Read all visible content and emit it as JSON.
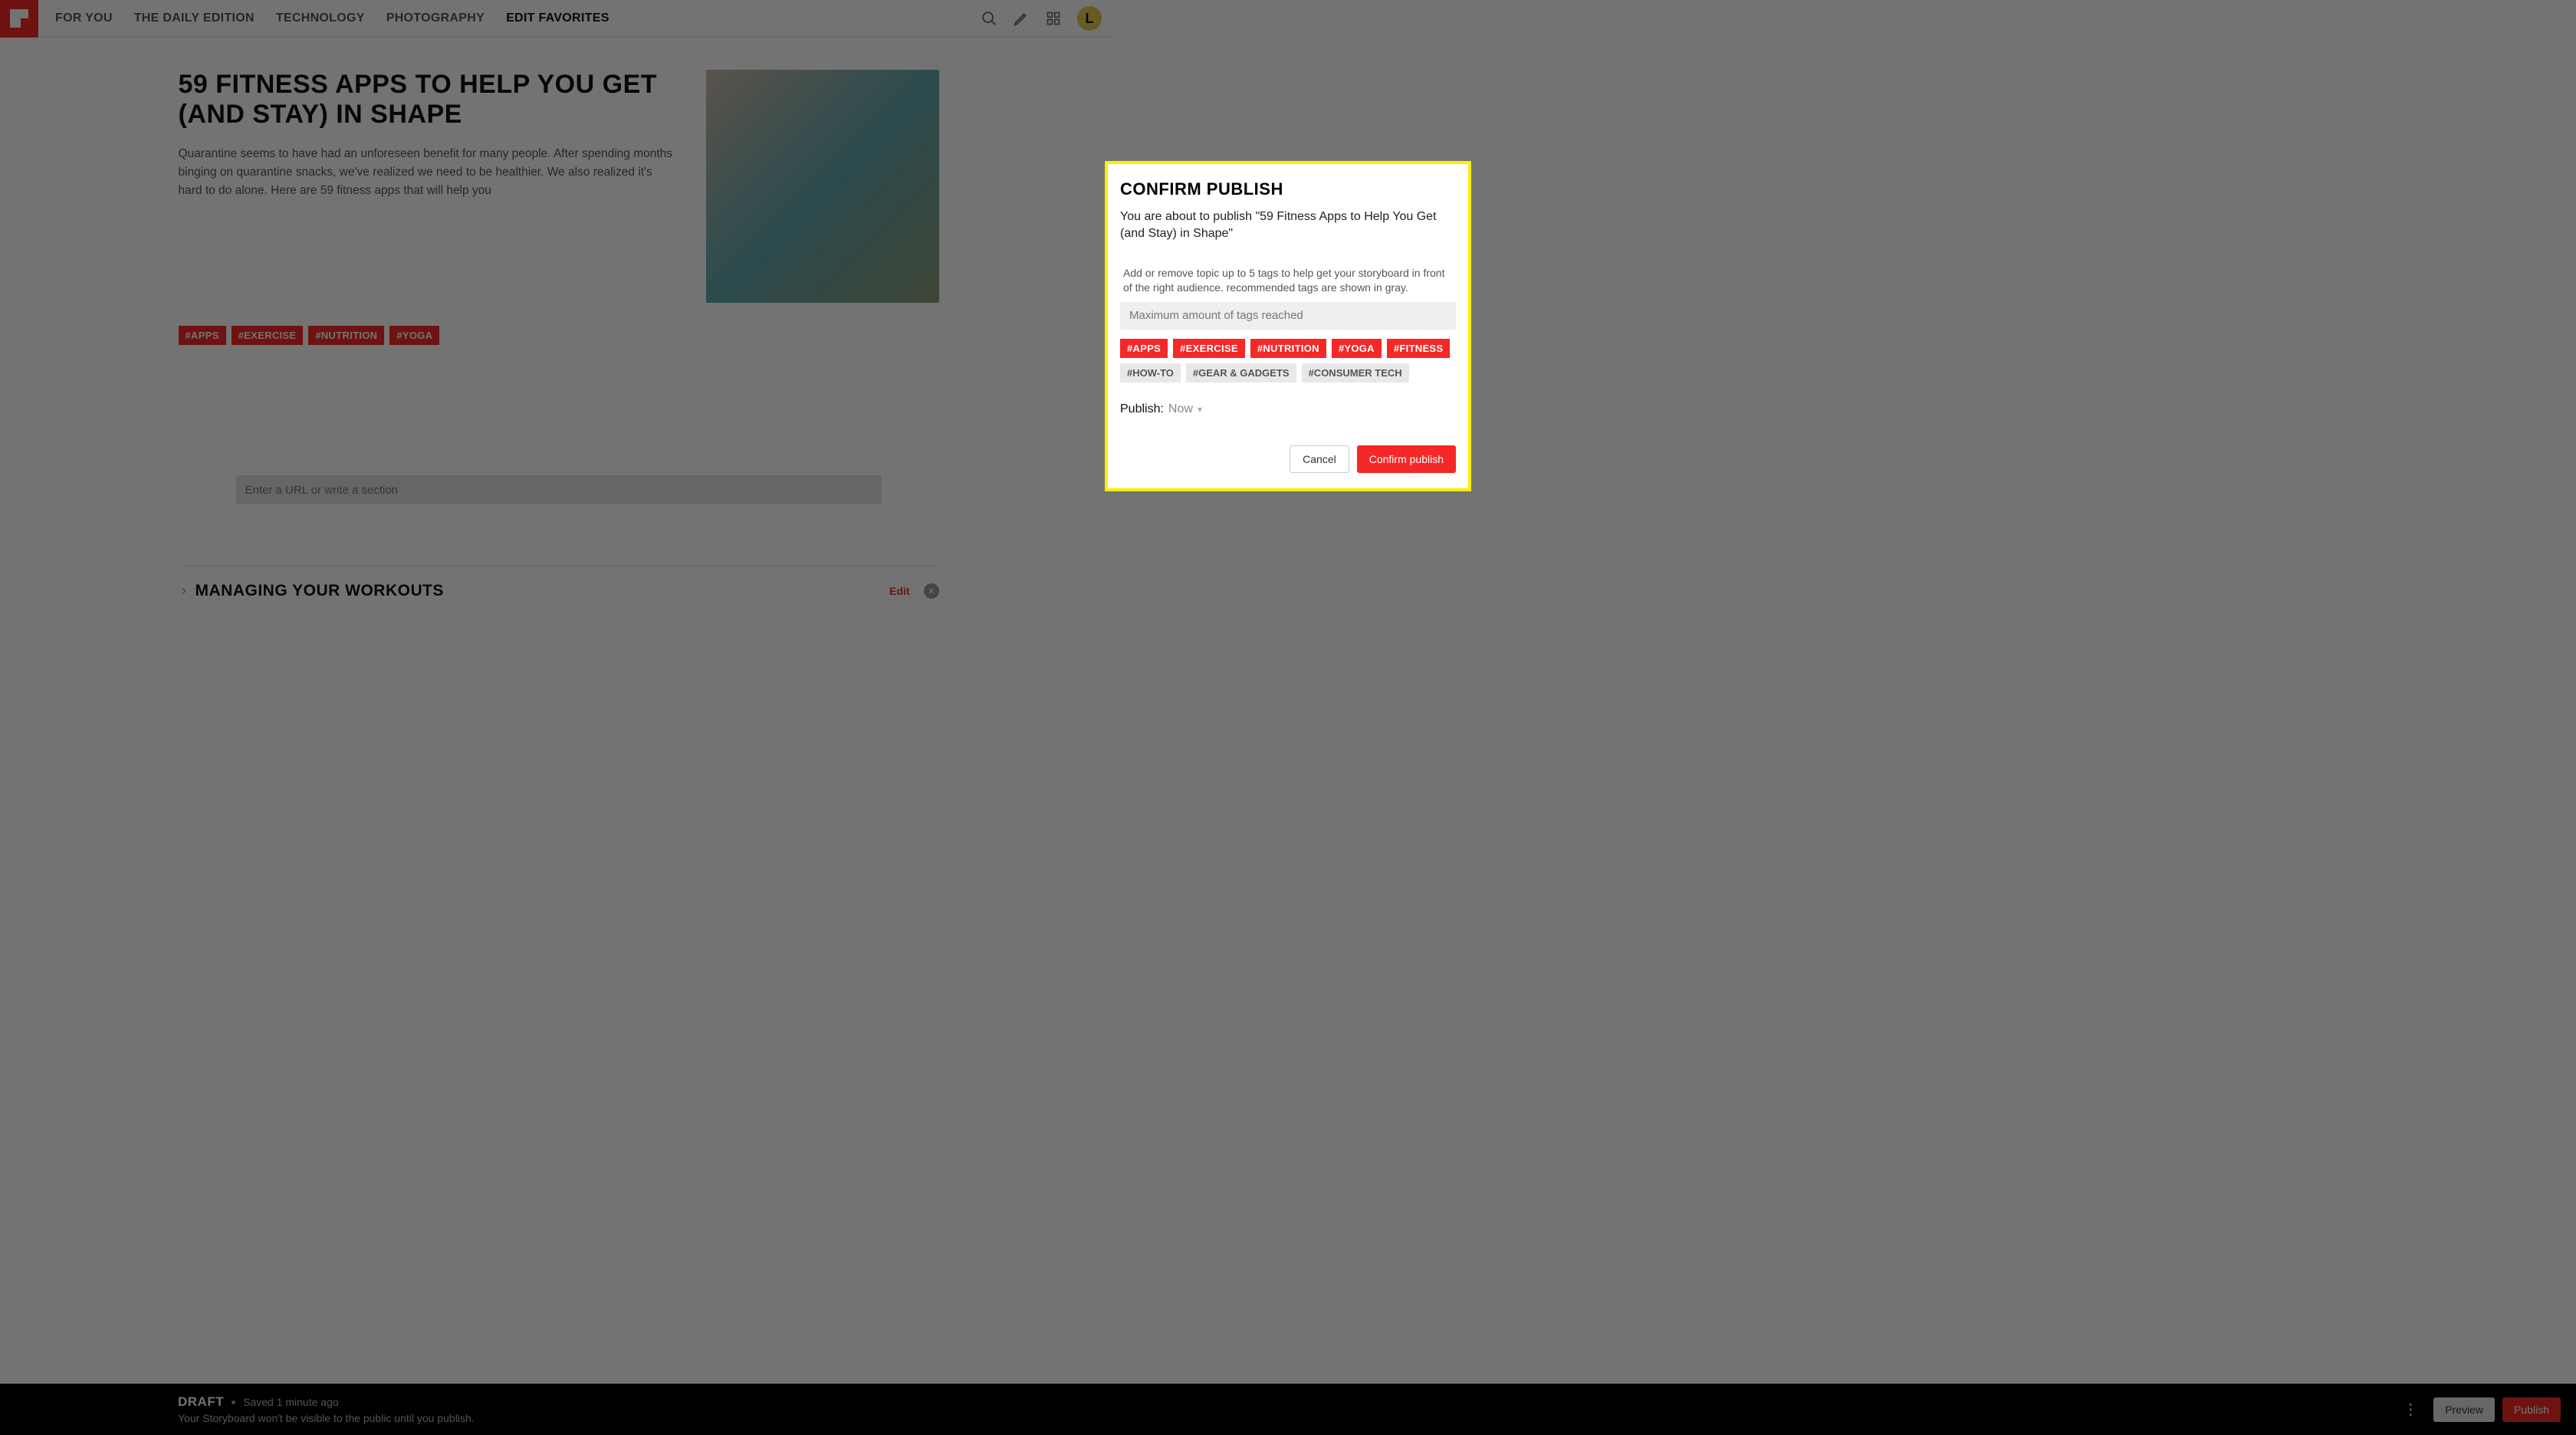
{
  "nav": {
    "items": [
      "FOR YOU",
      "THE DAILY EDITION",
      "TECHNOLOGY",
      "PHOTOGRAPHY",
      "EDIT FAVORITES"
    ],
    "avatar_initial": "L"
  },
  "article": {
    "title": "59 FITNESS APPS TO HELP YOU GET (AND STAY) IN SHAPE",
    "excerpt": "Quarantine seems to have had an unforeseen benefit for many people. After spending months binging on quarantine snacks, we've realized we need to be healthier. We also realized it's hard to do alone. Here are 59 fitness apps that will help you",
    "tags": [
      "#APPS",
      "#EXERCISE",
      "#NUTRITION",
      "#YOGA"
    ]
  },
  "url_input": {
    "placeholder": "Enter a URL or write a section"
  },
  "section": {
    "title": "MANAGING YOUR WORKOUTS",
    "edit_label": "Edit"
  },
  "bottombar": {
    "draft_label": "DRAFT",
    "saved_text": "Saved 1 minute ago",
    "note": "Your Storyboard won't be visible to the public until you publish.",
    "preview_label": "Preview",
    "publish_label": "Publish"
  },
  "modal": {
    "title": "CONFIRM PUBLISH",
    "subtitle": "You are about to publish \"59 Fitness Apps to Help You Get (and Stay) in Shape\"",
    "help": "Add or remove topic up to 5 tags to help get your storyboard in front of the right audience. recommended tags are shown in gray.",
    "input_placeholder": "Maximum amount of tags reached",
    "tags_active": [
      "#APPS",
      "#EXERCISE",
      "#NUTRITION",
      "#YOGA",
      "#FITNESS"
    ],
    "tags_suggested": [
      "#HOW-TO",
      "#GEAR & GADGETS",
      "#CONSUMER TECH"
    ],
    "publish_label": "Publish:",
    "publish_value": "Now",
    "cancel_label": "Cancel",
    "confirm_label": "Confirm publish"
  }
}
